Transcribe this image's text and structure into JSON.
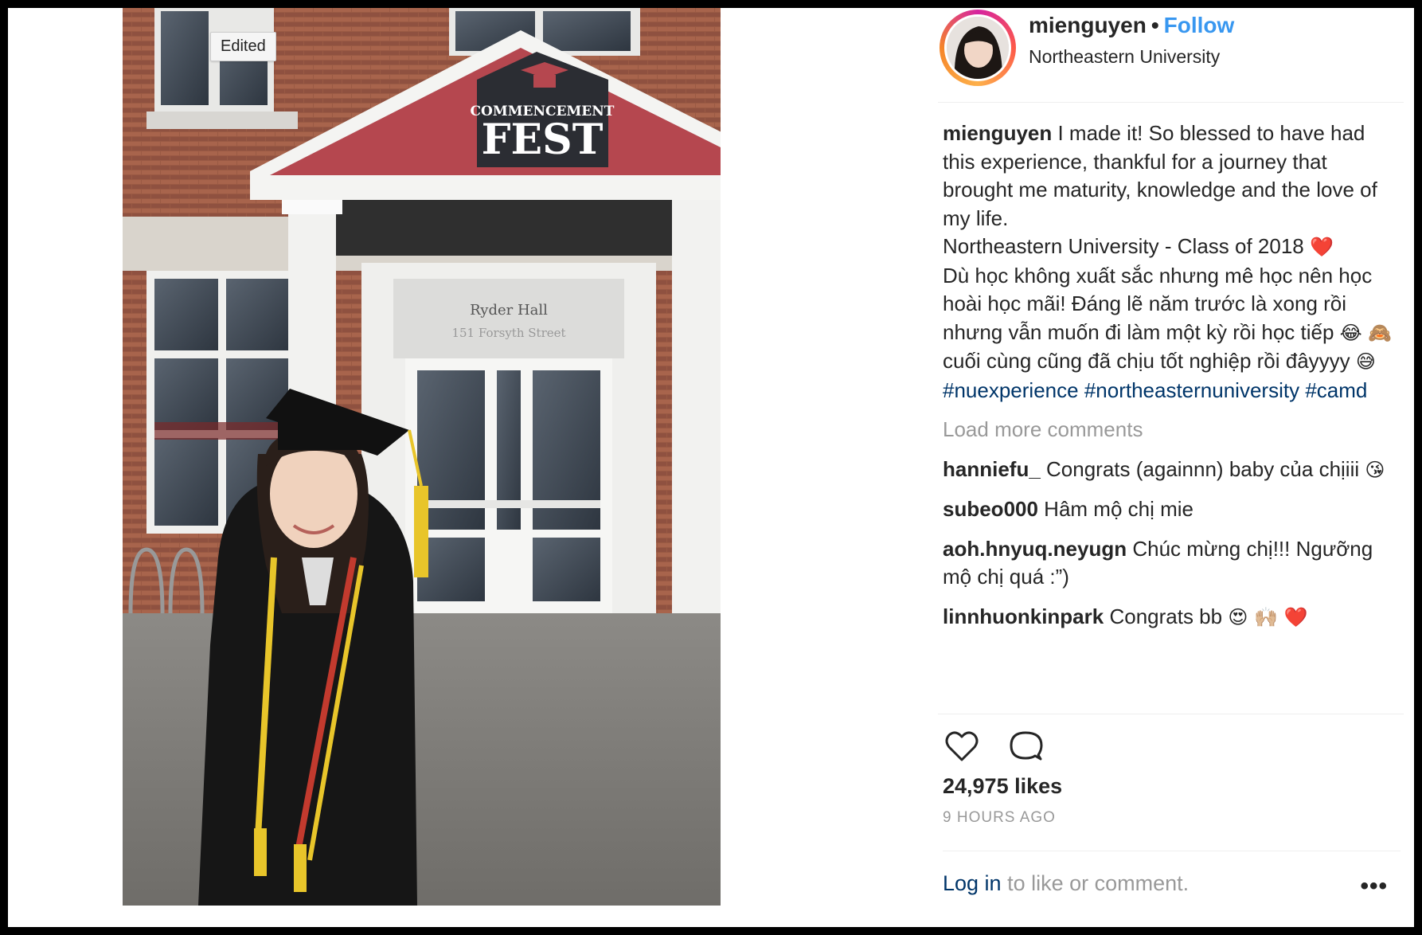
{
  "photo": {
    "edited_label": "Edited",
    "sign_line1": "COMMENCEMENT",
    "sign_line2": "FEST",
    "door_sign_line1": "Ryder Hall",
    "door_sign_line2": "151 Forsyth Street"
  },
  "header": {
    "username": "mienguyen",
    "separator": "•",
    "follow_label": "Follow",
    "location": "Northeastern University"
  },
  "caption": {
    "user": "mienguyen",
    "text1": " I made it! So blessed to have had this experience, thankful for a journey that brought me maturity, knowledge and the love of my life.",
    "text2": "Northeastern University - Class of 2018 ",
    "heart": "❤️",
    "text3": "Dù học không xuất sắc nhưng mê học nên học hoài học mãi! Đáng lẽ năm trước là xong rồi nhưng vẫn muốn đi làm một kỳ rồi học tiếp ",
    "emoji1": "😂",
    "emoji2": "🙈",
    "text4": "  cuối cùng cũng đã chịu tốt nghiệp rồi đâyyyy ",
    "emoji3": "😅",
    "hashtags": [
      "#nuexperience",
      "#northeasternuniversity",
      "#camd"
    ]
  },
  "load_more_label": "Load more comments",
  "comments": [
    {
      "user": "hanniefu_",
      "text": " Congrats (againnn) baby của chịiii ",
      "emoji": "😘"
    },
    {
      "user": "subeo000",
      "text": " Hâm mộ chị mie",
      "emoji": ""
    },
    {
      "user": "aoh.hnyuq.neyugn",
      "text": " Chúc mừng chị!!! Ngưỡng mộ chị quá :”)",
      "emoji": ""
    },
    {
      "user": "linnhuonkinpark",
      "text": " Congrats bb ",
      "emoji": "😍 🙌🏼 ❤️"
    }
  ],
  "actions": {
    "like_icon": "heart-outline-icon",
    "comment_icon": "comment-bubble-icon"
  },
  "likes_label": "24,975 likes",
  "timestamp": "9 HOURS AGO",
  "login": {
    "link_label": "Log in",
    "rest": " to like or comment."
  },
  "more_label": "•••",
  "colors": {
    "link_blue": "#3897f0",
    "hashtag": "#003569",
    "muted": "#999999",
    "text": "#262626"
  }
}
